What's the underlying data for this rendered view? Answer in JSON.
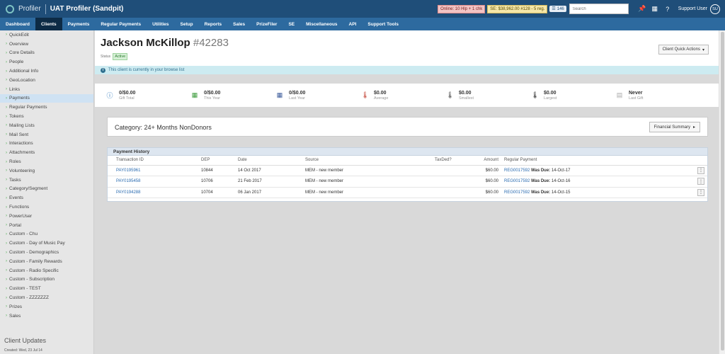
{
  "app": {
    "brand": "Profiler",
    "title": "UAT Profiler (Sandpit)",
    "online_badge": "Online: 10 Hlp + 1 chk",
    "se_badge": "SE: $38,962.00 #128 - 5 reg.",
    "count_badge": "146",
    "search_placeholder": "Search",
    "support_user": "Support User",
    "avatar_initials": "SU"
  },
  "nav": {
    "items": [
      "Dashboard",
      "Clients",
      "Payments",
      "Regular Payments",
      "Utilities",
      "Setup",
      "Reports",
      "Sales",
      "PrizeFiler",
      "SE",
      "Miscellaneous",
      "API",
      "Support Tools"
    ],
    "active": "Clients"
  },
  "sidebar": {
    "items": [
      "QuickEdit",
      "Overview",
      "Core Details",
      "People",
      "Additional Info",
      "GeoLocation",
      "Links",
      "Payments",
      "Regular Payments",
      "Tokens",
      "Mailing Lists",
      "Mail Sent",
      "Interactions",
      "Attachments",
      "Roles",
      "Volunteering",
      "Tasks",
      "Category/Segment",
      "Events",
      "Functions",
      "PowerUser",
      "Portal",
      "Custom - Chu",
      "Custom - Day of Music Pay",
      "Custom - Demographics",
      "Custom - Family Rewards",
      "Custom - Radio Specific",
      "Custom - Subscription",
      "Custom - TEST",
      "Custom - ZZZZZZZ",
      "Prizes",
      "Sales"
    ],
    "active": "Payments",
    "section_title": "Client Updates",
    "created": "Created: Wed, 23 Jul 14"
  },
  "client": {
    "name": "Jackson McKillop",
    "id": "#42283",
    "status_label": "Status",
    "status": "Active",
    "quick_actions": "Client Quick Actions",
    "notice": "This client is currently in your browse list"
  },
  "stats": [
    {
      "value": "0/$0.00",
      "label": "Gift Total",
      "icon": "info-icon",
      "color": "#1e6fb8"
    },
    {
      "value": "0/$0.00",
      "label": "This Year",
      "icon": "calendar-icon",
      "color": "#3a9a3a"
    },
    {
      "value": "0/$0.00",
      "label": "Last Year",
      "icon": "calendar-icon",
      "color": "#3a5a9a"
    },
    {
      "value": "$0.00",
      "label": "Average",
      "icon": "thermometer-icon",
      "color": "#c0392b"
    },
    {
      "value": "$0.00",
      "label": "Smallest",
      "icon": "thermometer-icon",
      "color": "#444"
    },
    {
      "value": "$0.00",
      "label": "Largest",
      "icon": "thermometer-icon",
      "color": "#222"
    },
    {
      "value": "Never",
      "label": "Last Gift",
      "icon": "document-icon",
      "color": "#aaa"
    }
  ],
  "category": {
    "title": "Category: 24+ Months NonDonors",
    "button": "Financial Summary"
  },
  "payment_history": {
    "title": "Payment History",
    "columns": [
      "Transaction ID",
      "DEP",
      "Date",
      "Source",
      "TaxDed?",
      "Amount",
      "Regular Payment"
    ],
    "due_label": "Was Due:",
    "rows": [
      {
        "id": "PAY0195961",
        "dep": "10844",
        "date": "14 Oct 2017",
        "source": "MEM - new member",
        "taxded": "",
        "amount": "$60.00",
        "reg": "REG0017592",
        "due": "14-Oct-17"
      },
      {
        "id": "PAY0195458",
        "dep": "10706",
        "date": "21 Feb 2017",
        "source": "MEM - new member",
        "taxded": "",
        "amount": "$60.00",
        "reg": "REG0017592",
        "due": "14-Oct-16"
      },
      {
        "id": "PAY0194288",
        "dep": "10704",
        "date": "06 Jan 2017",
        "source": "MEM - new member",
        "taxded": "",
        "amount": "$60.00",
        "reg": "REG0017592",
        "due": "14-Oct-15"
      }
    ]
  }
}
